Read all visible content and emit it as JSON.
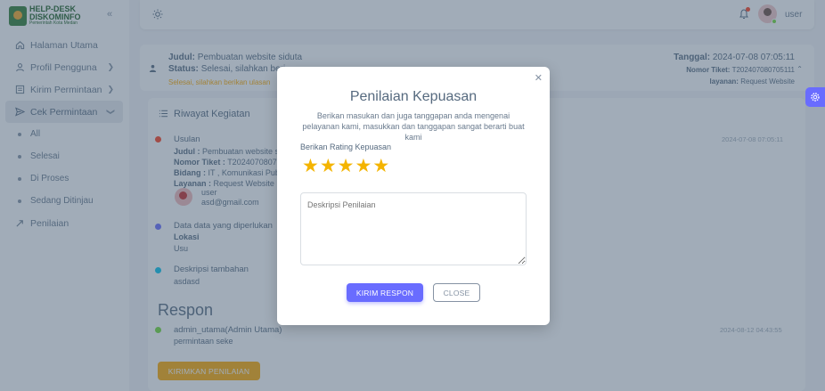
{
  "brand": {
    "line1": "HELP-DESK",
    "line2": "DISKOMINFO",
    "line3": "Pemerintah Kota Medan",
    "collapse_icon": "chevrons-left-icon"
  },
  "sidebar": {
    "items": [
      {
        "label": "Halaman Utama",
        "icon": "home-icon"
      },
      {
        "label": "Profil Pengguna",
        "icon": "user-icon"
      },
      {
        "label": "Kirim Permintaan",
        "icon": "form-icon"
      },
      {
        "label": "Cek Permintaan",
        "icon": "send-icon"
      }
    ],
    "submenu": [
      {
        "label": "All"
      },
      {
        "label": "Selesai"
      },
      {
        "label": "Di Proses"
      },
      {
        "label": "Sedang Ditinjau"
      }
    ],
    "penilaian": {
      "label": "Penilaian",
      "icon": "star-arrow-icon"
    }
  },
  "topbar": {
    "theme_icon": "sun-icon",
    "bell_icon": "bell-icon",
    "user_name": "user"
  },
  "ticket": {
    "judul_label": "Judul:",
    "judul_value": "Pembuatan website siduta",
    "status_label": "Status:",
    "status_value": "Selesai, silahkan beri",
    "status_sub": "Selesai, silahkan berikan ulasan",
    "tanggal_label": "Tanggal:",
    "tanggal_value": "2024-07-08 07:05:11",
    "nomor_label": "Nomor Tiket:",
    "nomor_value": "T202407080705111",
    "layanan_label": "layanan:",
    "layanan_value": "Request Website"
  },
  "activity": {
    "title": "Riwayat Kegiatan",
    "usulan": {
      "title": "Usulan",
      "time": "2024-07-08 07:05:11",
      "judul_label": "Judul :",
      "judul_value": "Pembuatan website si",
      "nomor_label": "Nomor Tiket :",
      "nomor_value": "T2024070807",
      "bidang_label": "Bidang :",
      "bidang_value": "IT , Komunikasi Publi",
      "layanan_label": "Layanan :",
      "layanan_value": "Request Website",
      "user_name": "user",
      "user_email": "asd@gmail.com"
    },
    "data": {
      "title": "Data data yang diperlukan",
      "field_label": "Lokasi",
      "field_value": "Usu"
    },
    "deskripsi": {
      "title": "Deskripsi tambahan",
      "value": "asdasd"
    },
    "respon_title": "Respon",
    "respon": {
      "author": "admin_utama(Admin Utama)",
      "message": "permintaan seke",
      "time": "2024-08-12 04:43:55"
    },
    "button": "KIRIMKAN PENILAIAN"
  },
  "modal": {
    "title": "Penilaian Kepuasan",
    "description": "Berikan masukan dan juga tanggapan anda mengenai pelayanan kami, masukkan dan tanggapan sangat berarti buat kami",
    "rating_label": "Berikan Rating Kepuasan",
    "rating": 5,
    "rating_max": 5,
    "textarea_placeholder": "Deskripsi Penilaian",
    "submit_label": "KIRIM RESPON",
    "close_label": "CLOSE"
  },
  "colors": {
    "primary": "#696cff",
    "warning": "#ffab00",
    "danger": "#ff3e1d",
    "success": "#71dd37",
    "info": "#03c3ec",
    "star": "#f4b400"
  }
}
